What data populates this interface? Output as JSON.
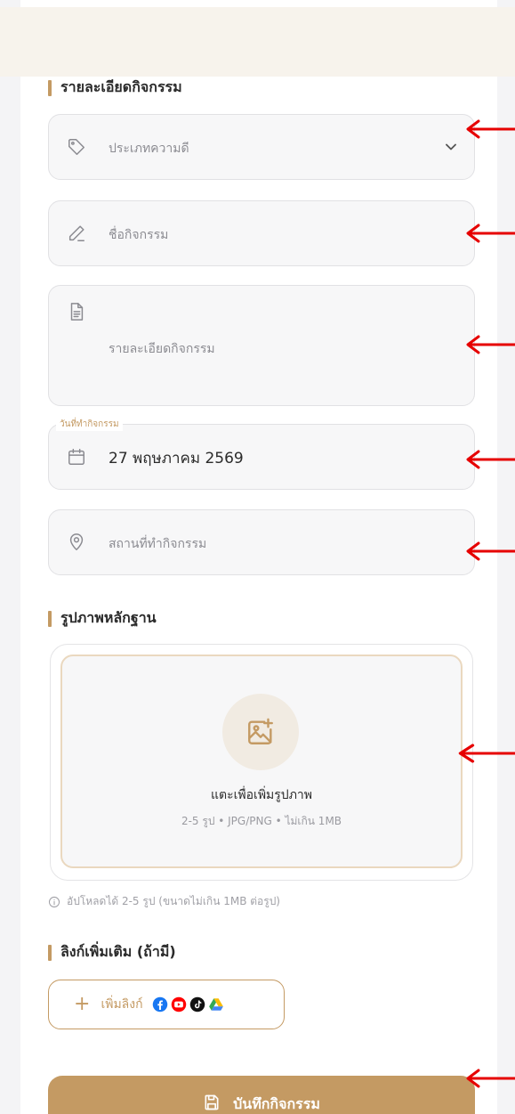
{
  "colors": {
    "accent": "#c49a63",
    "annotation_arrow": "#e60000",
    "field_bg": "#f7f7f8",
    "header_bg": "#f7f3ec"
  },
  "sections": {
    "activity_details": "รายละเอียดกิจกรรม",
    "evidence_photos": "รูปภาพหลักฐาน",
    "extra_links": "ลิงก์เพิ่มเติม (ถ้ามี)"
  },
  "form": {
    "category": {
      "placeholder": "ประเภทความดี",
      "icon": "tag-icon",
      "dropdown_icon": "chevron-down-icon"
    },
    "activity_name": {
      "placeholder": "ชื่อกิจกรรม",
      "icon": "pen-icon"
    },
    "activity_detail": {
      "placeholder": "รายละเอียดกิจกรรม",
      "icon": "document-icon"
    },
    "activity_date": {
      "legend": "วันที่ทำกิจกรรม",
      "value": "27 พฤษภาคม 2569",
      "icon": "calendar-icon"
    },
    "location": {
      "placeholder": "สถานที่ทำกิจกรรม",
      "icon": "location-pin-icon"
    }
  },
  "upload": {
    "icon": "image-add-icon",
    "title": "แตะเพื่อเพิ่มรูปภาพ",
    "subtitle": "2-5 รูป • JPG/PNG • ไม่เกิน 1MB",
    "note": "อัปโหลดได้ 2-5 รูป (ขนาดไม่เกิน 1MB ต่อรูป)",
    "note_icon": "info-icon"
  },
  "links": {
    "add_label": "เพิ่มลิงก์",
    "add_icon": "plus-icon",
    "platforms": [
      "facebook-icon",
      "youtube-icon",
      "tiktok-icon",
      "google-drive-icon"
    ]
  },
  "save_button": {
    "label": "บันทึกกิจกรรม",
    "icon": "save-icon"
  }
}
